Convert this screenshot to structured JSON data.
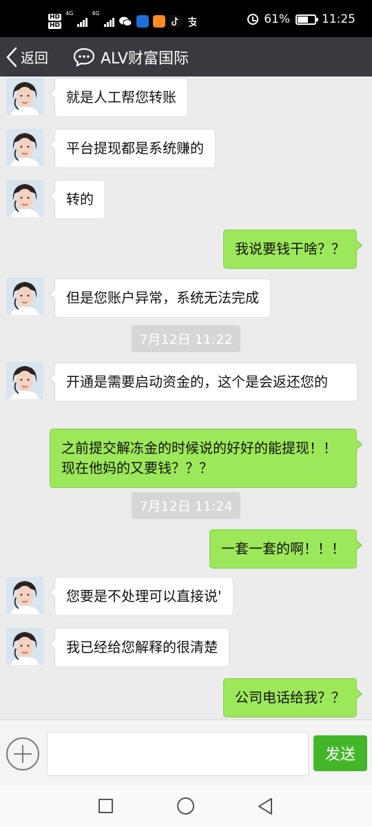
{
  "status_bar": {
    "hd_1": "HD",
    "hd_2": "HD",
    "network_1": "4G",
    "network_2": "4G",
    "battery_percent": "61%",
    "battery_level": 0.61,
    "time": "11:25",
    "icons": [
      "hd-icon",
      "signal-icon",
      "signal-icon",
      "wechat-icon",
      "app-icon",
      "app-icon",
      "tiktok-icon",
      "alipay-icon",
      "alarm-icon",
      "battery-icon"
    ]
  },
  "header": {
    "back_label": "返回",
    "title": "ALV财富国际",
    "colors": {
      "bar": "#393a3f",
      "text": "#ffffff"
    }
  },
  "messages": [
    {
      "type": "in",
      "text": "就是人工帮您转账"
    },
    {
      "type": "in",
      "text": "平台提现都是系统赚的"
    },
    {
      "type": "in",
      "text": "转的"
    },
    {
      "type": "out",
      "text": "我说要钱干啥？？"
    },
    {
      "type": "in",
      "text": "但是您账户异常，系统无法完成"
    },
    {
      "type": "time",
      "text": "7月12日 11:22"
    },
    {
      "type": "in",
      "text": "开通是需要启动资金的，这个是会返还您的"
    },
    {
      "type": "out",
      "text": "之前提交解冻金的时候说的好好的能提现！！现在他妈的又要钱？？？"
    },
    {
      "type": "time",
      "text": "7月12日 11:24"
    },
    {
      "type": "out",
      "text": "一套一套的啊！！！"
    },
    {
      "type": "in",
      "text": "您要是不处理可以直接说'"
    },
    {
      "type": "in",
      "text": "我已经给您解释的很清楚"
    },
    {
      "type": "out",
      "text": "公司电话给我？？"
    }
  ],
  "input": {
    "value": "",
    "send_label": "发送",
    "colors": {
      "send": "#44b62a"
    }
  },
  "colors": {
    "chat_background": "#ececec",
    "incoming_bubble": "#ffffff",
    "outgoing_bubble": "#9de85a"
  }
}
